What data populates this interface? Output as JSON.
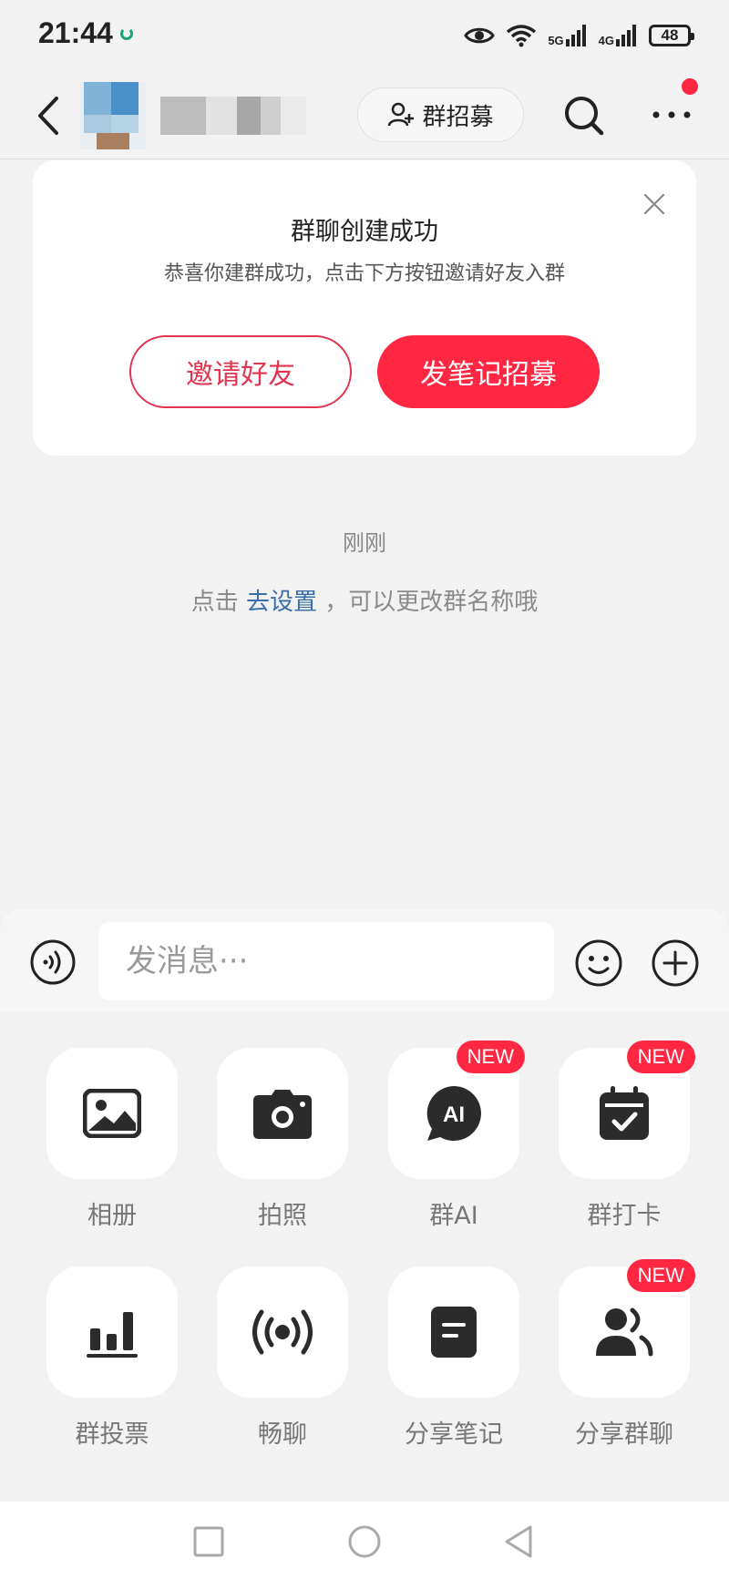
{
  "status_bar": {
    "time": "21:44",
    "network_5g": "5G",
    "network_4g": "4G",
    "battery": "48"
  },
  "header": {
    "recruit_label": "群招募"
  },
  "card": {
    "title": "群聊创建成功",
    "subtitle": "恭喜你建群成功，点击下方按钮邀请好友入群",
    "invite_label": "邀请好友",
    "post_label": "发笔记招募"
  },
  "chat": {
    "timestamp": "刚刚",
    "tip_prefix": "点击 ",
    "tip_link": "去设置",
    "tip_suffix": " ，可以更改群名称哦"
  },
  "input": {
    "placeholder": "发消息···"
  },
  "tools": [
    {
      "label": "相册",
      "icon": "album-icon",
      "badge": ""
    },
    {
      "label": "拍照",
      "icon": "camera-icon",
      "badge": ""
    },
    {
      "label": "群AI",
      "icon": "ai-chat-icon",
      "badge": "NEW"
    },
    {
      "label": "群打卡",
      "icon": "calendar-check-icon",
      "badge": "NEW"
    },
    {
      "label": "群投票",
      "icon": "bar-chart-icon",
      "badge": ""
    },
    {
      "label": "畅聊",
      "icon": "broadcast-icon",
      "badge": ""
    },
    {
      "label": "分享笔记",
      "icon": "note-icon",
      "badge": ""
    },
    {
      "label": "分享群聊",
      "icon": "group-users-icon",
      "badge": "NEW"
    }
  ],
  "ai_icon_text": "AI",
  "colors": {
    "accent": "#ff2741",
    "link": "#3a6ea8",
    "background": "#f2f2f3"
  }
}
